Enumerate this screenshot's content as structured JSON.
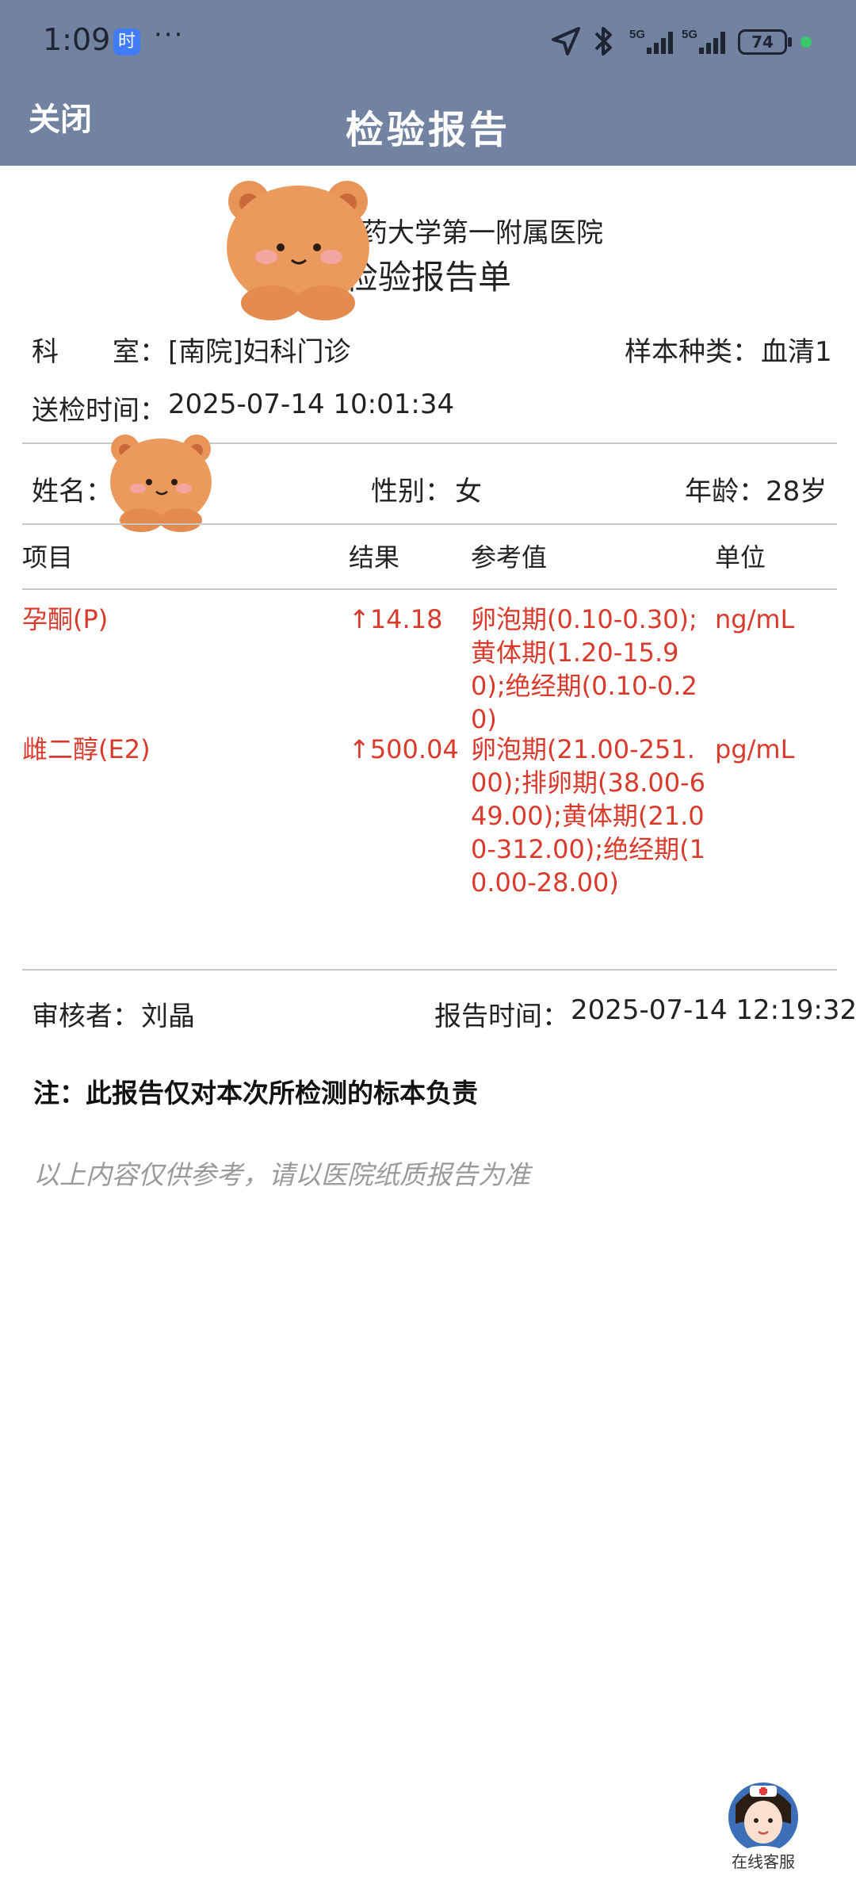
{
  "status_bar": {
    "time": "1:09",
    "app_badge": "时",
    "more": "···",
    "network_1": "5G",
    "network_2": "5G",
    "battery": "74"
  },
  "header": {
    "close_label": "关闭",
    "title": "检验报告"
  },
  "report": {
    "hospital": "天津中医药大学第一附属医院",
    "heading": "检验报告单",
    "department_label": "科　　室：",
    "department": "[南院]妇科门诊",
    "sample_label": "样本种类：",
    "sample": "血清1",
    "sent_label": "送检时间：",
    "sent_time": "2025-07-14 10:01:34",
    "name_label": "姓名：",
    "name": "",
    "gender_label": "性别：",
    "gender": "女",
    "age_label": "年龄：",
    "age": "28岁"
  },
  "table": {
    "headers": [
      "项目",
      "结果",
      "参考值",
      "单位"
    ],
    "rows": [
      {
        "item": "孕酮(P)",
        "result": "↑14.18",
        "reference": "卵泡期(0.10-0.30);黄体期(1.20-15.90);绝经期(0.10-0.20)",
        "unit": "ng/mL"
      },
      {
        "item": "雌二醇(E2)",
        "result": "↑500.04",
        "reference": "卵泡期(21.00-251.00);排卵期(38.00-649.00);黄体期(21.00-312.00);绝经期(10.00-28.00)",
        "unit": "pg/mL"
      }
    ]
  },
  "footer": {
    "reviewer_label": "审核者：",
    "reviewer": "刘晶",
    "report_time_label": "报告时间：",
    "report_time": "2025-07-14 12:19:32",
    "note": "注：此报告仅对本次所检测的标本负责",
    "disclaimer": "以上内容仅供参考，请以医院纸质报告为准"
  },
  "customer_service": {
    "label": "在线客服"
  },
  "colors": {
    "header_bg": "#7282a1",
    "abnormal_red": "#d93a2b",
    "disclaimer_gray": "#9a9a9a"
  }
}
